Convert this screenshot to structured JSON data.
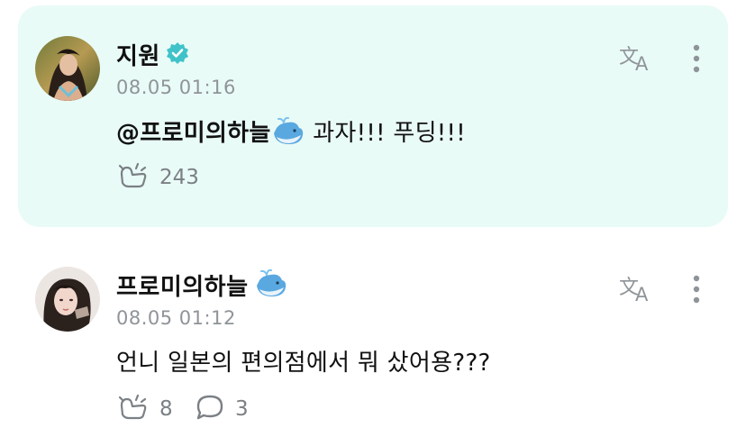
{
  "comments": [
    {
      "author": "지원",
      "verified": true,
      "timestamp": "08.05 01:16",
      "mention": "@프로미의하늘",
      "text": " 과자!!! 푸딩!!!",
      "likes": "243",
      "highlighted": true
    },
    {
      "author": "프로미의하늘",
      "verified": false,
      "timestamp": "08.05 01:12",
      "text": "언니 일본의 편의점에서 뭐 샀어용???",
      "likes": "8",
      "replies": "3",
      "highlighted": false
    }
  ],
  "colors": {
    "highlight_bg": "#e9fbf7",
    "verified": "#3fc3c9",
    "muted": "#8f9499"
  },
  "icons": [
    "verified-badge-icon",
    "translate-icon",
    "more-vertical-icon",
    "like-icon",
    "reply-icon",
    "whale-emoji-icon"
  ]
}
